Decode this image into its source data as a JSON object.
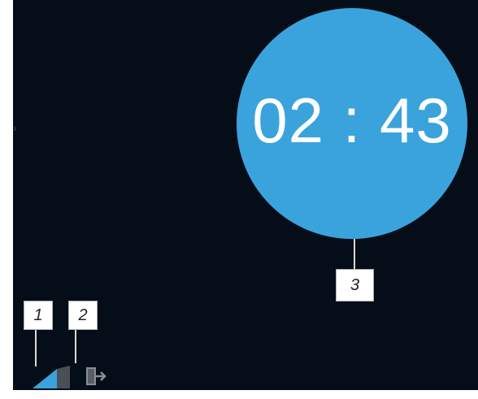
{
  "timer": {
    "value": "02 : 43",
    "circle_color": "#3aa3dc"
  },
  "callouts": [
    {
      "label": "1"
    },
    {
      "label": "2"
    },
    {
      "label": "3"
    }
  ],
  "icons": {
    "signal": "signal-strength-icon",
    "exit": "exit-door-icon",
    "left_arrow": "chevron-right-icon"
  },
  "colors": {
    "background": "#050e18",
    "accent": "#3aa3dc"
  }
}
